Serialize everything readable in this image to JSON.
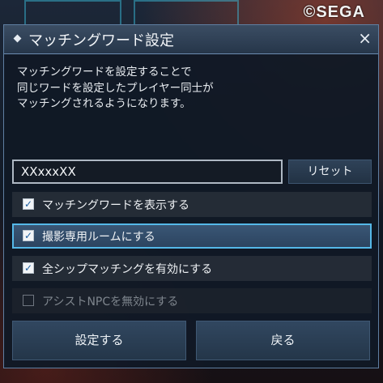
{
  "logo": {
    "text": "©SEGA"
  },
  "dialog": {
    "title": "マッチングワード設定",
    "close_symbol": "×",
    "description": "マッチングワードを設定することで\n同じワードを設定したプレイヤー同士が\nマッチングされるようになります。",
    "word_input": {
      "value": "XXxxxXX"
    },
    "reset_label": "リセット",
    "options": [
      {
        "label": "マッチングワードを表示する",
        "checked": true,
        "enabled": true
      },
      {
        "label": "撮影専用ルームにする",
        "checked": true,
        "enabled": true,
        "selected": true
      },
      {
        "label": "全シップマッチングを有効にする",
        "checked": true,
        "enabled": true
      },
      {
        "label": "アシストNPCを無効にする",
        "checked": false,
        "enabled": false
      }
    ],
    "confirm_label": "設定する",
    "back_label": "戻る",
    "check_mark": "✓"
  },
  "colors": {
    "accent_border": "#55b8e8",
    "panel": "#111925",
    "title_bar": "#2f4156"
  }
}
